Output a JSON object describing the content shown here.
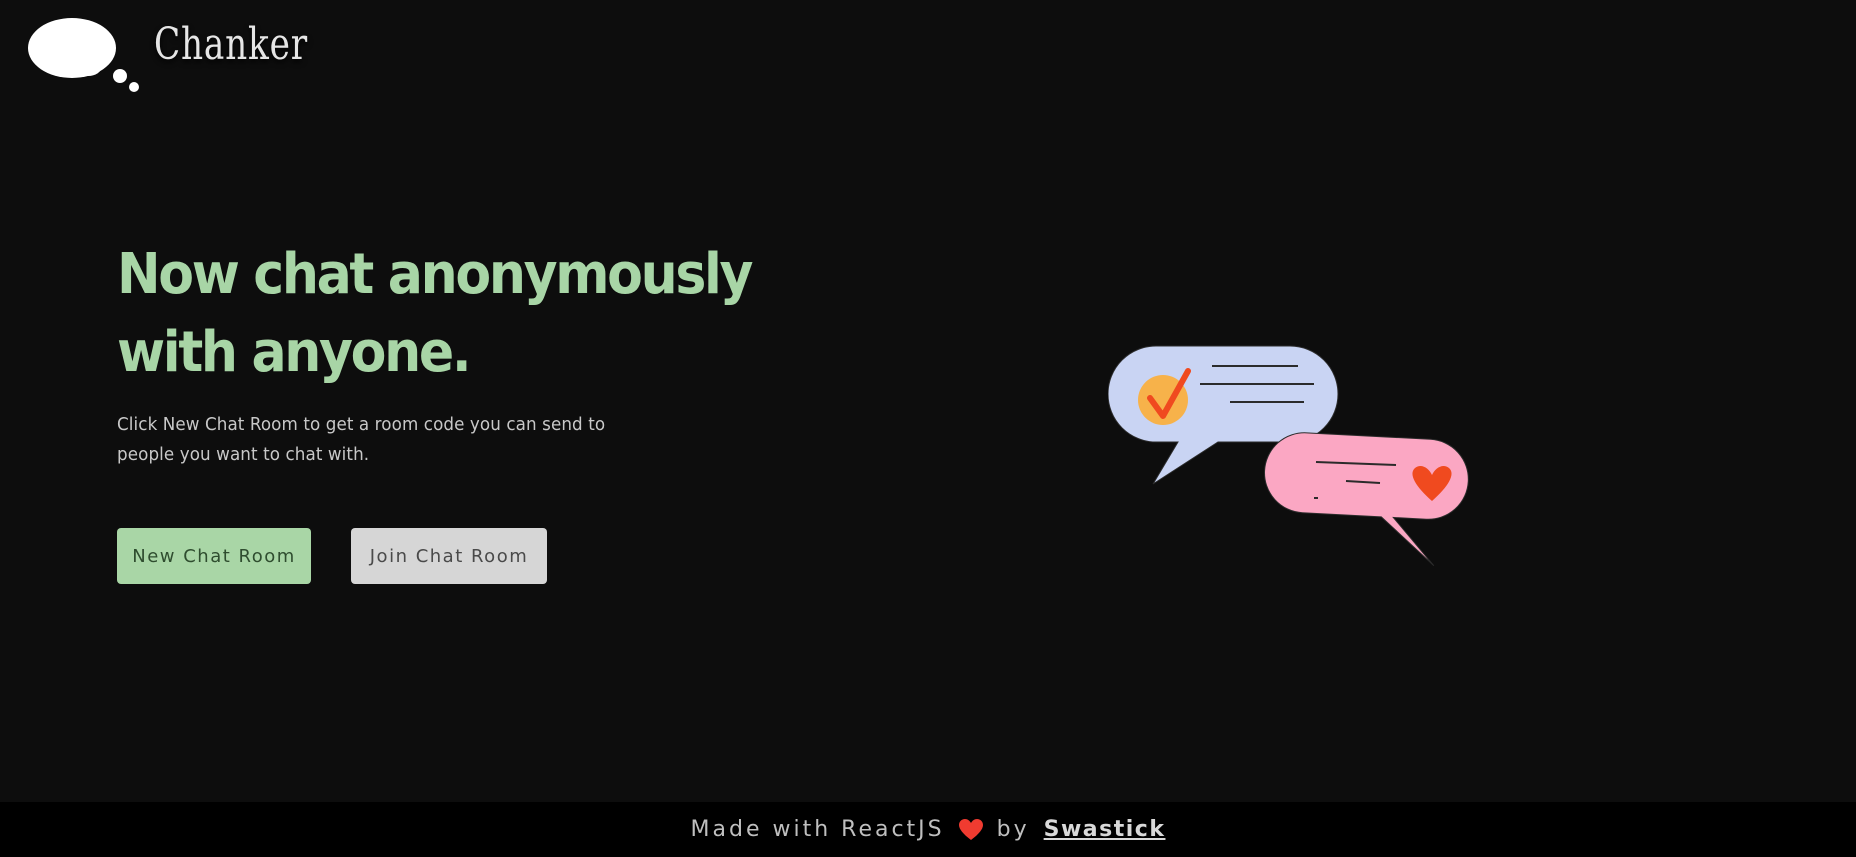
{
  "brand": {
    "name": "Chanker"
  },
  "hero": {
    "title": "Now chat anonymously with anyone.",
    "subtitle": "Click New Chat Room to get a room code you can send to people you want to chat with.",
    "new_room_label": "New Chat Room",
    "join_room_label": "Join Chat Room"
  },
  "illustration": {
    "icon": "chat-bubbles-illustration",
    "colors": {
      "bubble_blue": "#c9d4f3",
      "bubble_pink": "#fba7c3",
      "check_circle": "#f7b24a",
      "accent_red": "#f04a1f"
    }
  },
  "footer": {
    "made_with": "Made with ReactJS",
    "by": "by",
    "author": "Swastick",
    "heart_icon": "heart-icon",
    "heart_color": "#f03b30"
  },
  "colors": {
    "background": "#0d0d0d",
    "footer_background": "#000000",
    "accent_green": "#a8d5a6",
    "button_gray": "#d6d6d6"
  }
}
